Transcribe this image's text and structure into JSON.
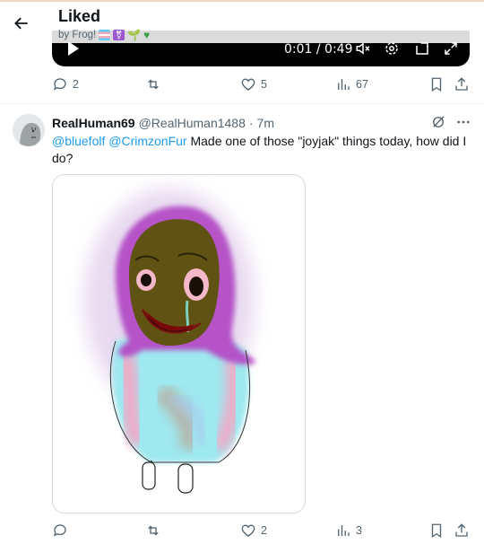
{
  "header": {
    "title": "Liked",
    "subtitle": "by Frog!",
    "subtitle_emojis": [
      "trans-flag-emoji",
      "nonbinary-symbol-emoji",
      "seedling-emoji",
      "green-heart-emoji"
    ]
  },
  "video": {
    "time": "0:01 / 0:49"
  },
  "prev_tweet_actions": {
    "replies": "2",
    "retweets": "",
    "likes": "5",
    "views": "67"
  },
  "tweet": {
    "display_name": "RealHuman69",
    "handle": "@RealHuman1488",
    "separator": "·",
    "time": "7m",
    "mention1": "@bluefolf",
    "mention2": "@CrimzonFur",
    "text": "Made one of those \"joyjak\" things today, how did I do?",
    "actions": {
      "replies": "",
      "retweets": "",
      "likes": "2",
      "views": "3"
    }
  },
  "colors": {
    "accent": "#1d9bf0",
    "muted": "#536471",
    "text": "#0f1419",
    "border": "#cfd9de"
  }
}
